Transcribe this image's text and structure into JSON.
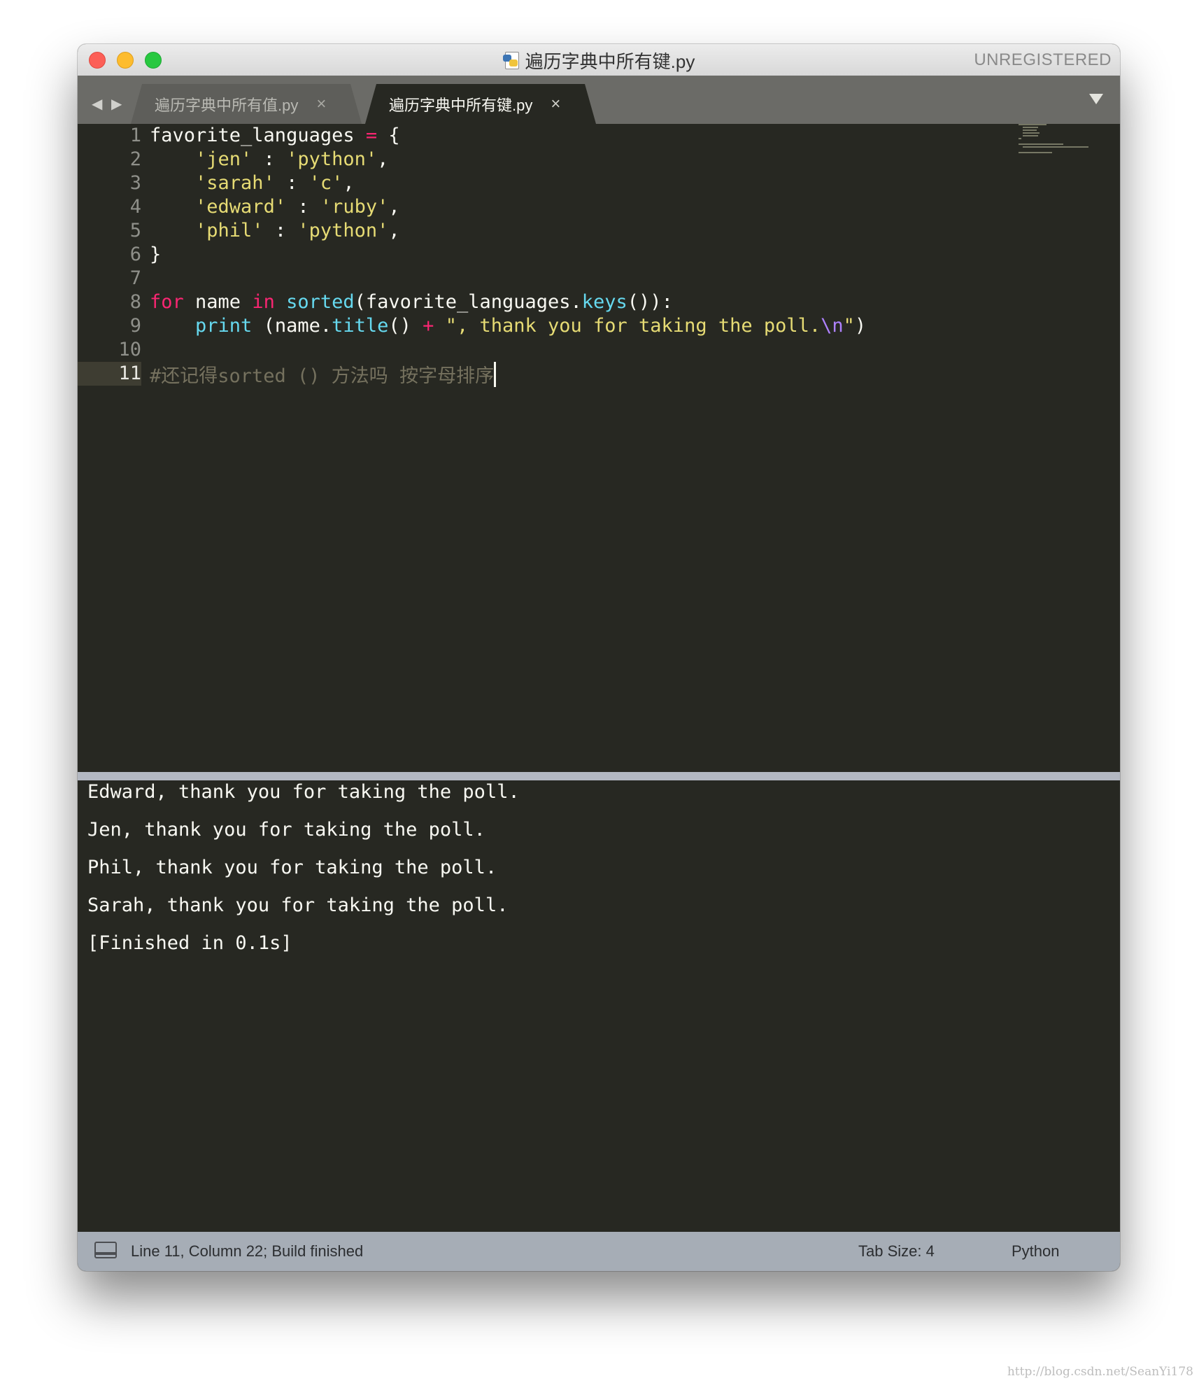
{
  "window": {
    "title": "遍历字典中所有键.py",
    "license": "UNREGISTERED"
  },
  "tabs": [
    {
      "label": "遍历字典中所有值.py",
      "close": "×"
    },
    {
      "label": "遍历字典中所有键.py",
      "close": "×"
    }
  ],
  "nav": {
    "back": "◀",
    "forward": "▶"
  },
  "gutter": [
    "1",
    "2",
    "3",
    "4",
    "5",
    "6",
    "7",
    "8",
    "9",
    "10",
    "11"
  ],
  "code": {
    "l1_a": "favorite_languages ",
    "l1_op": "=",
    "l1_b": " {",
    "l2_indent": "    ",
    "l2_k": "'jen'",
    "l2_sep": " : ",
    "l2_v": "'python'",
    "l2_end": ",",
    "l3_indent": "    ",
    "l3_k": "'sarah'",
    "l3_sep": " : ",
    "l3_v": "'c'",
    "l3_end": ",",
    "l4_indent": "    ",
    "l4_k": "'edward'",
    "l4_sep": " : ",
    "l4_v": "'ruby'",
    "l4_end": ",",
    "l5_indent": "    ",
    "l5_k": "'phil'",
    "l5_sep": " : ",
    "l5_v": "'python'",
    "l5_end": ",",
    "l6": "}",
    "l8_for": "for",
    "l8_a": " name ",
    "l8_in": "in",
    "l8_sp": " ",
    "l8_sorted": "sorted",
    "l8_b": "(favorite_languages.",
    "l8_keys": "keys",
    "l8_c": "()):",
    "l9_indent": "    ",
    "l9_print": "print",
    "l9_a": " (name.",
    "l9_title": "title",
    "l9_b": "() ",
    "l9_plus": "+",
    "l9_sp": " ",
    "l9_str": "\", thank you for taking the poll.",
    "l9_esc": "\\n",
    "l9_q": "\"",
    "l9_c": ")",
    "l11_comment": "#还记得sorted () 方法吗 按字母排序"
  },
  "output": [
    "Edward, thank you for taking the poll.",
    "Jen, thank you for taking the poll.",
    "Phil, thank you for taking the poll.",
    "Sarah, thank you for taking the poll.",
    "[Finished in 0.1s]"
  ],
  "status": {
    "position": "Line 11, Column 22; Build finished",
    "tab_size": "Tab Size: 4",
    "syntax": "Python"
  },
  "watermark": "http://blog.csdn.net/SeanYi178",
  "colors": {
    "background": "#272822",
    "keyword": "#f92672",
    "string": "#e6db74",
    "function": "#66d9ef",
    "escape": "#ae81ff",
    "comment": "#75715e"
  },
  "icons": [
    "python-file-icon",
    "panel-toggle-icon",
    "tab-dropdown-icon",
    "close-icon"
  ]
}
